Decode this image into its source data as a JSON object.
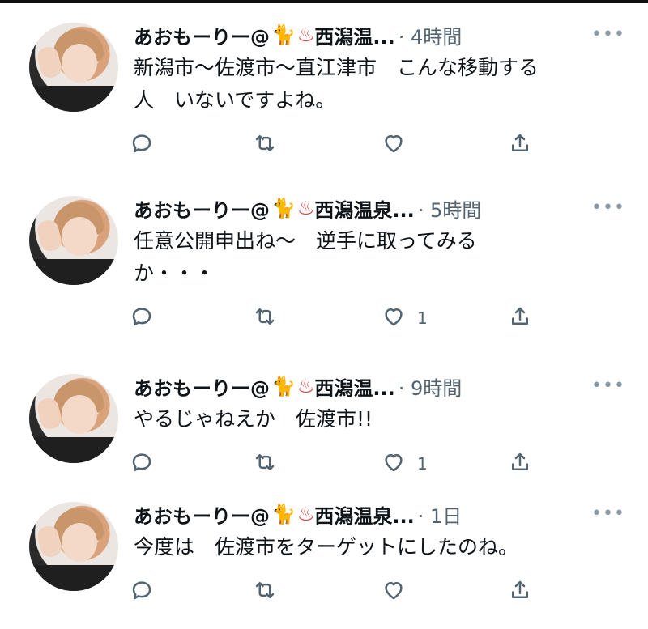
{
  "icons": {
    "reply": "reply-icon",
    "retweet": "retweet-icon",
    "like": "heart-icon",
    "share": "share-icon",
    "more": "more-icon"
  },
  "tweets": [
    {
      "display_name": "あおもーりー@",
      "cat_emoji": "🐈",
      "spring_emoji": "♨",
      "name_suffix": "西潟温...",
      "time": "· 4時間",
      "more": "•••",
      "text": "新潟市〜佐渡市〜直江津市　こんな移動する\n人　いないですよね。",
      "like_count": ""
    },
    {
      "display_name": "あおもーりー@",
      "cat_emoji": "🐈",
      "spring_emoji": "♨",
      "name_suffix": "西潟温泉...",
      "time": "· 5時間",
      "more": "•••",
      "text": "任意公開申出ね〜　逆手に取ってみる\nか・・・",
      "like_count": "1"
    },
    {
      "display_name": "あおもーりー@",
      "cat_emoji": "🐈",
      "spring_emoji": "♨",
      "name_suffix": "西潟温...",
      "time": "· 9時間",
      "more": "•••",
      "text": "やるじゃねえか　佐渡市!!",
      "like_count": "1"
    },
    {
      "display_name": "あおもーりー@",
      "cat_emoji": "🐈",
      "spring_emoji": "♨",
      "name_suffix": "西潟温泉...",
      "time": "· 1日",
      "more": "•••",
      "text": "今度は　佐渡市をターゲットにしたのね。",
      "like_count": ""
    }
  ]
}
